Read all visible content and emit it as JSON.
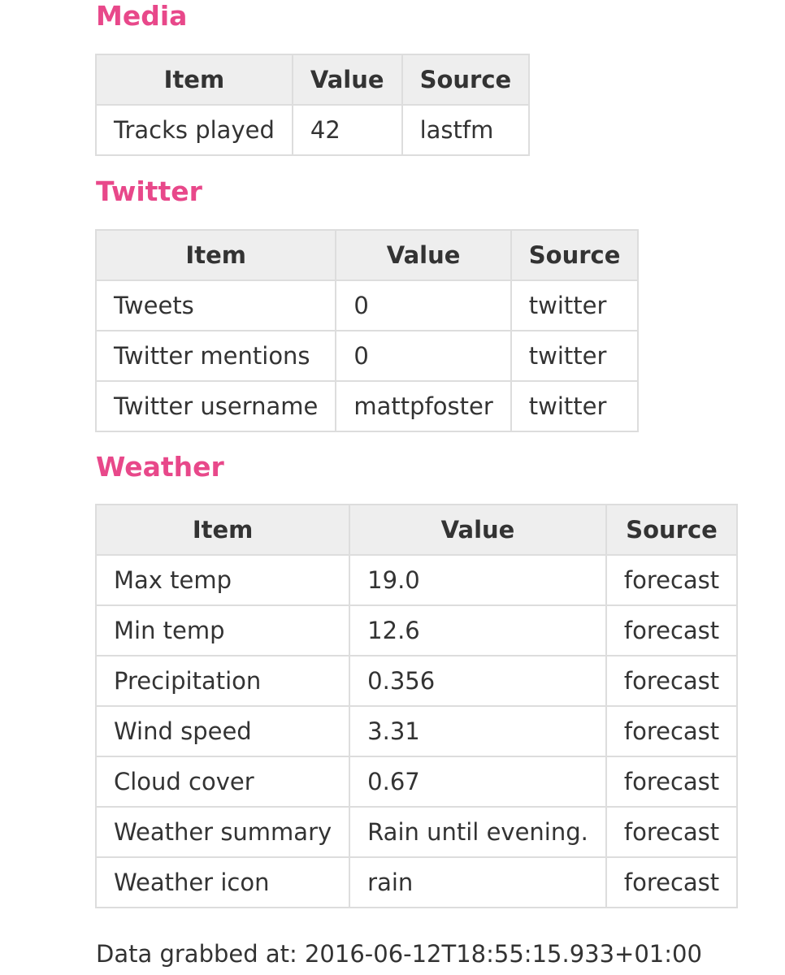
{
  "colors": {
    "heading": "#e8488a",
    "header_bg": "#eeeeee",
    "border": "#dddddd",
    "text": "#333333"
  },
  "sections": [
    {
      "title": "Media",
      "headers": [
        "Item",
        "Value",
        "Source"
      ],
      "rows": [
        [
          "Tracks played",
          "42",
          "lastfm"
        ]
      ]
    },
    {
      "title": "Twitter",
      "headers": [
        "Item",
        "Value",
        "Source"
      ],
      "rows": [
        [
          "Tweets",
          "0",
          "twitter"
        ],
        [
          "Twitter mentions",
          "0",
          "twitter"
        ],
        [
          "Twitter username",
          "mattpfoster",
          "twitter"
        ]
      ]
    },
    {
      "title": "Weather",
      "headers": [
        "Item",
        "Value",
        "Source"
      ],
      "rows": [
        [
          "Max temp",
          "19.0",
          "forecast"
        ],
        [
          "Min temp",
          "12.6",
          "forecast"
        ],
        [
          "Precipitation",
          "0.356",
          "forecast"
        ],
        [
          "Wind speed",
          "3.31",
          "forecast"
        ],
        [
          "Cloud cover",
          "0.67",
          "forecast"
        ],
        [
          "Weather summary",
          "Rain until evening.",
          "forecast"
        ],
        [
          "Weather icon",
          "rain",
          "forecast"
        ]
      ]
    }
  ],
  "footer": {
    "text": "Data grabbed at: 2016-06-12T18:55:15.933+01:00"
  }
}
